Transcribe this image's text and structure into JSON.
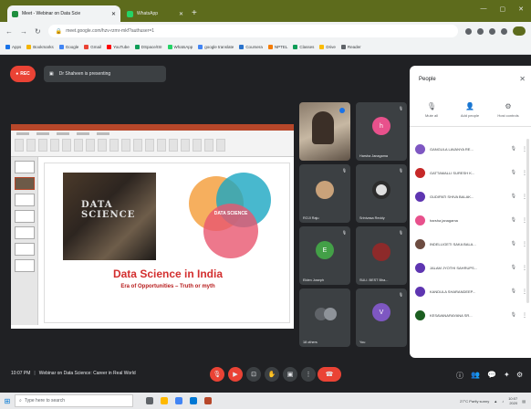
{
  "browser": {
    "tabs": [
      {
        "label": "Meet - Webinar on Data Scie",
        "active": true
      },
      {
        "label": "WhatsApp",
        "active": false
      }
    ],
    "url": "meet.google.com/hzv-rzmr-mkf?authuser=1",
    "bookmarks": [
      "Apps",
      "Bookmarks",
      "Google",
      "Gmail",
      "YouTube",
      "DSpace/ISI",
      "WhatsApp",
      "google translate",
      "Coursera",
      "NPTEL",
      "Classes",
      "Drive",
      "Reader"
    ]
  },
  "meet": {
    "rec_label": "REC",
    "presenting_text": "Dr Shaheen is presenting",
    "slide": {
      "photo_text_line1": "DATA",
      "photo_text_line2": "SCIENCE",
      "venn_center": "DATA SCIENCE",
      "title": "Data Science in India",
      "subtitle": "Era of Opportunities – Truth or myth"
    },
    "tiles": [
      {
        "name": "",
        "type": "video"
      },
      {
        "name": "Harsha Janagama",
        "initial": "h",
        "color": "#e8518c"
      },
      {
        "name": "ROJI Raju",
        "type": "photo",
        "color": "#c9a27a"
      },
      {
        "name": "Srinivasa Reddy",
        "type": "photo",
        "color": "#2c2c2c"
      },
      {
        "name": "Elden Joseph",
        "initial": "E",
        "color": "#43a047"
      },
      {
        "name": "SULI. BEST Bha...",
        "type": "photo",
        "color": "#8d2a2a"
      },
      {
        "name": "18 others",
        "type": "group",
        "color": "#5f6368"
      },
      {
        "name": "You",
        "initial": "V",
        "color": "#7e57c2"
      }
    ],
    "people_panel": {
      "title": "People",
      "actions": [
        {
          "label": "Mute all",
          "icon": "mic-off-icon"
        },
        {
          "label": "Add people",
          "icon": "person-add-icon"
        },
        {
          "label": "Host controls",
          "icon": "host-controls-icon"
        }
      ],
      "participants": [
        {
          "name": "GANGULA LAVANYA RE...",
          "color": "#7e57c2"
        },
        {
          "name": "GATTAMALLI SURESH K...",
          "color": "#c62828"
        },
        {
          "name": "GUDIPATI SHIVA BALAK...",
          "color": "#5e35b1"
        },
        {
          "name": "harsha janagama",
          "color": "#e8518c"
        },
        {
          "name": "INDELLIGETI SAKA BALA...",
          "color": "#6d4c41"
        },
        {
          "name": "JALAM JYOTHI SAHRUPS...",
          "color": "#5e35b1"
        },
        {
          "name": "KANDULA SHARANDEEP...",
          "color": "#5e35b1"
        },
        {
          "name": "KESAVANARAYANA SR...",
          "color": "#1b5e20"
        }
      ]
    },
    "bottom": {
      "time": "10:07 PM",
      "meeting_title": "Webinar on Data Science: Career in Real World"
    }
  },
  "taskbar": {
    "search_placeholder": "Type here to search",
    "weather": "27°C Partly sunny",
    "time": "10:07",
    "date": "2020"
  }
}
